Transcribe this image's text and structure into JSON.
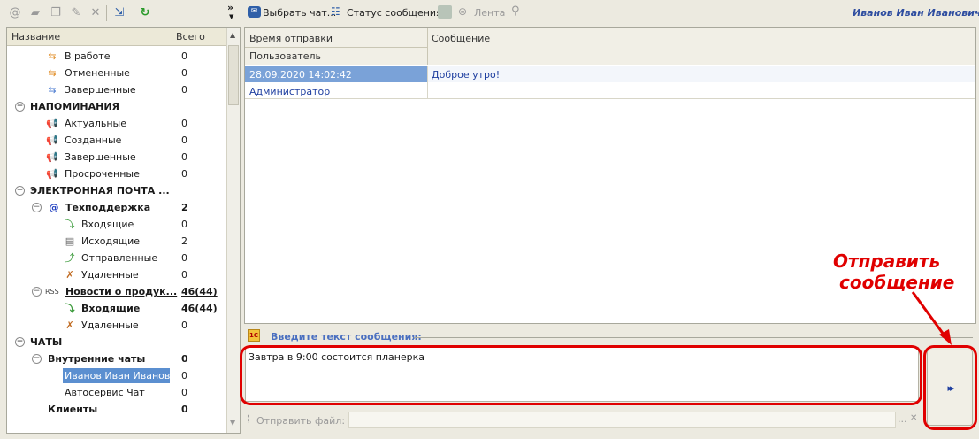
{
  "left_toolbar": {
    "icons": [
      "at-icon",
      "folder-icon",
      "copy-icon",
      "edit-pencil-icon",
      "delete-x-icon",
      "export-icon",
      "refresh-icon"
    ],
    "overflow": "»"
  },
  "tree": {
    "col_name": "Название",
    "col_total": "Всего",
    "rows": [
      {
        "label": "В работе",
        "count": "0"
      },
      {
        "label": "Отмененные",
        "count": "0"
      },
      {
        "label": "Завершенные",
        "count": "0"
      },
      {
        "label": "НАПОМИНАНИЯ",
        "count": ""
      },
      {
        "label": "Актуальные",
        "count": "0"
      },
      {
        "label": "Созданные",
        "count": "0"
      },
      {
        "label": "Завершенные",
        "count": "0"
      },
      {
        "label": "Просроченные",
        "count": "0"
      },
      {
        "label": "ЭЛЕКТРОННАЯ ПОЧТА ...",
        "count": ""
      },
      {
        "label": "Техподдержка",
        "count": "2"
      },
      {
        "label": "Входящие",
        "count": "0"
      },
      {
        "label": "Исходящие",
        "count": "2"
      },
      {
        "label": "Отправленные",
        "count": "0"
      },
      {
        "label": "Удаленные",
        "count": "0"
      },
      {
        "label": "Новости о продук...",
        "count": "46(44)",
        "prefix": "RSS"
      },
      {
        "label": "Входящие",
        "count": "46(44)"
      },
      {
        "label": "Удаленные",
        "count": "0"
      },
      {
        "label": "ЧАТЫ",
        "count": ""
      },
      {
        "label": "Внутренние чаты",
        "count": "0"
      },
      {
        "label": "Иванов Иван Иванов...",
        "count": "0"
      },
      {
        "label": "Автосервис Чат",
        "count": "0"
      },
      {
        "label": "Клиенты",
        "count": "0"
      }
    ]
  },
  "right_toolbar": {
    "choose_chat": "Выбрать чат...",
    "message_status": "Статус сообщения",
    "feed": "Лента",
    "user_name": "Иванов Иван Иванович"
  },
  "messages": {
    "col_time": "Время отправки",
    "col_message": "Сообщение",
    "col_user": "Пользователь",
    "items": [
      {
        "time": "28.09.2020 14:02:42",
        "text": "Доброе утро!",
        "user": "Администратор"
      }
    ]
  },
  "compose": {
    "prompt": "Введите текст сообщения:",
    "text": "Завтра в 9:00 состоится планерка",
    "attach_label": "Отправить файл:",
    "attach_dots": "...",
    "attach_clear": "✕",
    "send_glyph": "▸▸"
  },
  "annotation": {
    "line1": "Отправить",
    "line2": "сообщение",
    "color": "#e00000"
  }
}
